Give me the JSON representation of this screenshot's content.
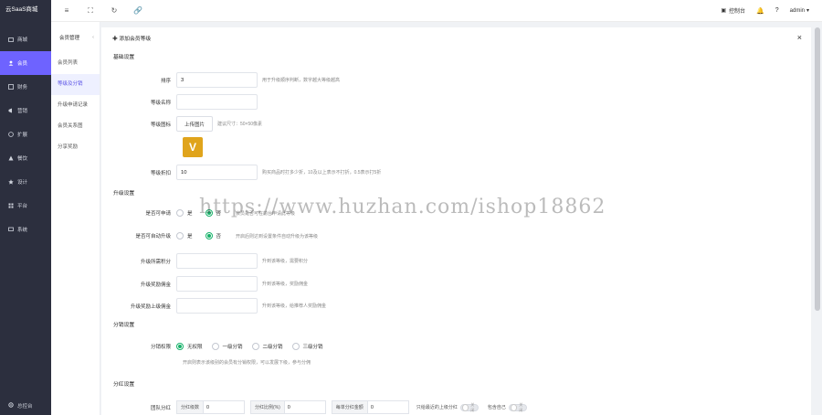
{
  "brand": "云SaaS商城",
  "sidebar": {
    "items": [
      {
        "label": "商城",
        "icon": "store-icon",
        "active": false
      },
      {
        "label": "会员",
        "icon": "user-icon",
        "active": true
      },
      {
        "label": "财务",
        "icon": "finance-icon",
        "active": false
      },
      {
        "label": "营销",
        "icon": "megaphone-icon",
        "active": false
      },
      {
        "label": "扩展",
        "icon": "extension-icon",
        "active": false
      },
      {
        "label": "餐饮",
        "icon": "restaurant-icon",
        "active": false
      },
      {
        "label": "设计",
        "icon": "design-icon",
        "active": false
      },
      {
        "label": "平台",
        "icon": "platform-icon",
        "active": false
      },
      {
        "label": "系统",
        "icon": "system-icon",
        "active": false
      }
    ],
    "footer": "总控台"
  },
  "submenu": {
    "title": "会员管理",
    "items": [
      {
        "label": "会员列表",
        "active": false
      },
      {
        "label": "等级及分销",
        "active": true
      },
      {
        "label": "升级申请记录",
        "active": false
      },
      {
        "label": "会员关系图",
        "active": false
      },
      {
        "label": "分享奖励",
        "active": false
      }
    ]
  },
  "topbar": {
    "console": "控制台",
    "user": "admin"
  },
  "panel": {
    "title": "✚ 添加会员等级",
    "basic": {
      "section": "基础设置",
      "sort_label": "排序",
      "sort_value": "3",
      "sort_hint": "用于升级顺序判断，数字越大等级越高",
      "name_label": "等级名称",
      "name_value": "",
      "icon_label": "等级图标",
      "upload_label": "上传图片",
      "icon_hint": "建议尺寸：50×50像素",
      "discount_label": "等级折扣",
      "discount_value": "10",
      "discount_hint": "购买商品时打多少折，10及以上表示不打折，0.5表示打5折"
    },
    "upgrade": {
      "section": "升级设置",
      "apply_label": "是否可申请",
      "apply_yes": "是",
      "apply_no": "否",
      "apply_hint": "会员是否可在前台申请此等级",
      "auto_label": "是否可自动升级",
      "auto_yes": "是",
      "auto_no": "否",
      "auto_hint": "开启后则达到设置条件自动升级为该等级",
      "points_label": "升级所需积分",
      "points_hint": "升到该等级，需要积分",
      "reward_label": "升级奖励佣金",
      "reward_hint": "升到该等级，奖励佣金",
      "commission_label": "升级奖励上级佣金",
      "commission_hint": "升到该等级，给推荐人奖励佣金"
    },
    "distribution": {
      "section": "分销设置",
      "perm_label": "分销权限",
      "options": [
        "无权限",
        "一级分销",
        "二级分销",
        "三级分销"
      ],
      "selected": 0,
      "hint": "开启则表示该级别的会员有分销权限，可以发展下级，参与分佣"
    },
    "dividend": {
      "section": "分红设置",
      "team_label": "团队分红",
      "count_prefix": "分红级数",
      "count_value": "0",
      "ratio_prefix": "分红比例(%)",
      "ratio_value": "0",
      "amount_prefix": "每单分红金额",
      "amount_value": "0",
      "nearest_label": "只给最近的上级分红",
      "self_label": "包含自己",
      "switch_off": "关闭"
    }
  },
  "watermark": "https://www.huzhan.com/ishop18862"
}
